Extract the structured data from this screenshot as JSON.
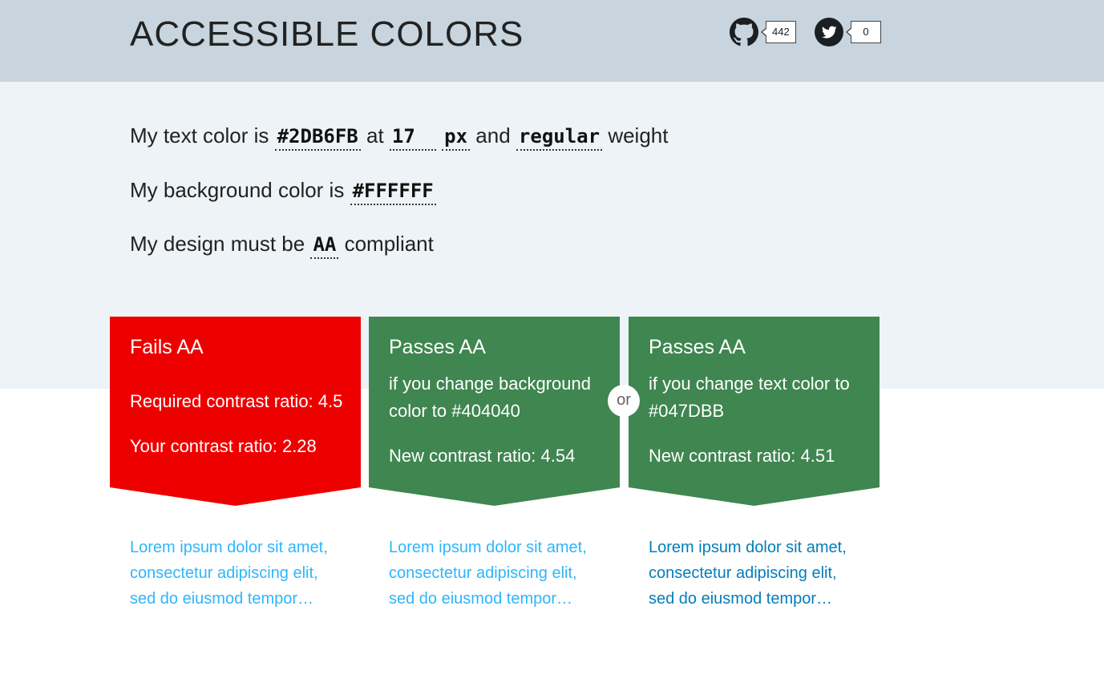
{
  "header": {
    "title": "ACCESSIBLE COLORS",
    "github": {
      "icon": "github-icon",
      "count": "442"
    },
    "twitter": {
      "icon": "twitter-icon",
      "count": "0"
    }
  },
  "settings": {
    "text_color_prefix": "My text color is",
    "text_color_value": "#2DB6FB",
    "at_label": "at",
    "font_size_value": "17",
    "unit_value": "px",
    "and_label": "and",
    "weight_value": "regular",
    "weight_suffix": "weight",
    "bg_prefix": "My background color is",
    "bg_value": "#FFFFFF",
    "compliance_prefix": "My design must be",
    "compliance_value": "AA",
    "compliance_suffix": "compliant"
  },
  "cards": [
    {
      "title": "Fails AA",
      "required": "Required contrast ratio: 4.5",
      "ratio": "Your contrast ratio: 2.28",
      "sample": "Lorem ipsum dolor sit amet, consectetur adipiscing elit, sed do eiusmod tempor…",
      "color": "#ef0000"
    },
    {
      "title": "Passes AA",
      "description": "if you change background color to #404040",
      "ratio": "New contrast ratio: 4.54",
      "sample": "Lorem ipsum dolor sit amet, consectetur adipiscing elit, sed do eiusmod tempor…",
      "color": "#3f8650",
      "sample_background": "#404040"
    },
    {
      "title": "Passes AA",
      "description": "if you change text color to #047DBB",
      "ratio": "New contrast ratio: 4.51",
      "sample": "Lorem ipsum dolor sit amet, consectetur adipiscing elit, sed do eiusmod tempor…",
      "color": "#3f8650",
      "sample_text_color": "#047DBB"
    }
  ],
  "or_label": "or"
}
